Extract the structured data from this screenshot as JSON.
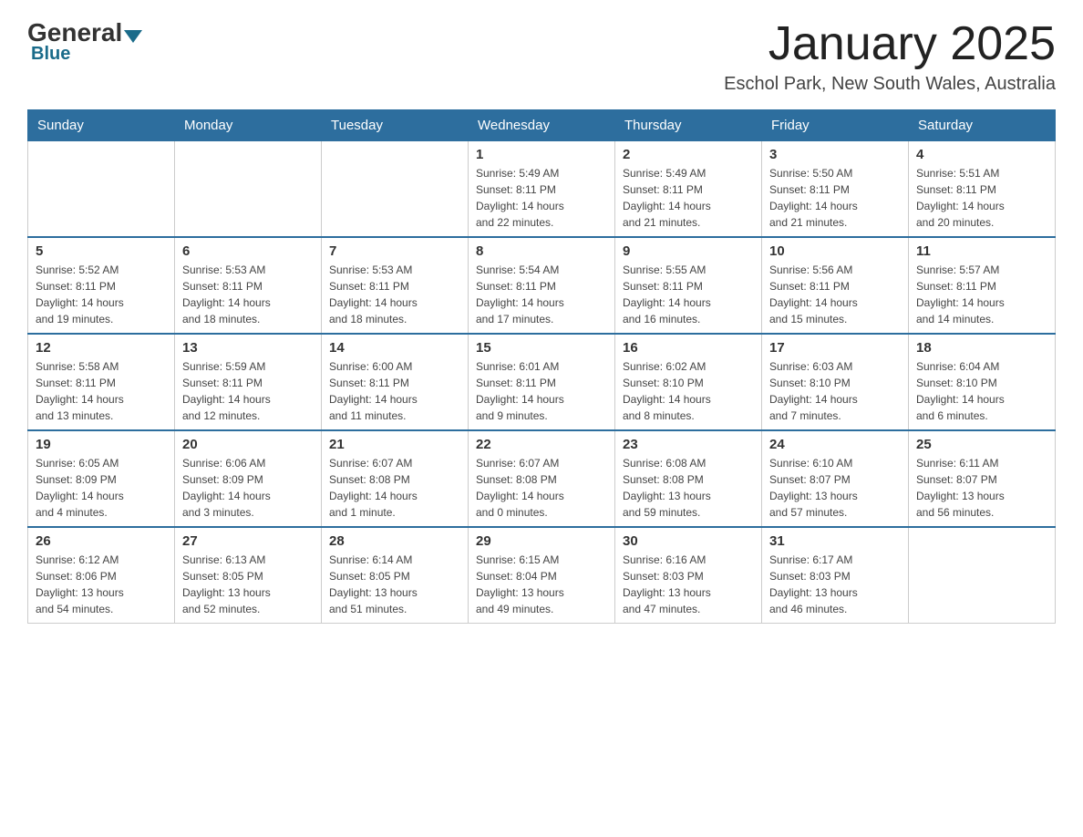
{
  "header": {
    "logo_general": "General",
    "logo_blue": "Blue",
    "month_title": "January 2025",
    "location": "Eschol Park, New South Wales, Australia"
  },
  "weekdays": [
    "Sunday",
    "Monday",
    "Tuesday",
    "Wednesday",
    "Thursday",
    "Friday",
    "Saturday"
  ],
  "weeks": [
    [
      {
        "day": "",
        "info": ""
      },
      {
        "day": "",
        "info": ""
      },
      {
        "day": "",
        "info": ""
      },
      {
        "day": "1",
        "info": "Sunrise: 5:49 AM\nSunset: 8:11 PM\nDaylight: 14 hours\nand 22 minutes."
      },
      {
        "day": "2",
        "info": "Sunrise: 5:49 AM\nSunset: 8:11 PM\nDaylight: 14 hours\nand 21 minutes."
      },
      {
        "day": "3",
        "info": "Sunrise: 5:50 AM\nSunset: 8:11 PM\nDaylight: 14 hours\nand 21 minutes."
      },
      {
        "day": "4",
        "info": "Sunrise: 5:51 AM\nSunset: 8:11 PM\nDaylight: 14 hours\nand 20 minutes."
      }
    ],
    [
      {
        "day": "5",
        "info": "Sunrise: 5:52 AM\nSunset: 8:11 PM\nDaylight: 14 hours\nand 19 minutes."
      },
      {
        "day": "6",
        "info": "Sunrise: 5:53 AM\nSunset: 8:11 PM\nDaylight: 14 hours\nand 18 minutes."
      },
      {
        "day": "7",
        "info": "Sunrise: 5:53 AM\nSunset: 8:11 PM\nDaylight: 14 hours\nand 18 minutes."
      },
      {
        "day": "8",
        "info": "Sunrise: 5:54 AM\nSunset: 8:11 PM\nDaylight: 14 hours\nand 17 minutes."
      },
      {
        "day": "9",
        "info": "Sunrise: 5:55 AM\nSunset: 8:11 PM\nDaylight: 14 hours\nand 16 minutes."
      },
      {
        "day": "10",
        "info": "Sunrise: 5:56 AM\nSunset: 8:11 PM\nDaylight: 14 hours\nand 15 minutes."
      },
      {
        "day": "11",
        "info": "Sunrise: 5:57 AM\nSunset: 8:11 PM\nDaylight: 14 hours\nand 14 minutes."
      }
    ],
    [
      {
        "day": "12",
        "info": "Sunrise: 5:58 AM\nSunset: 8:11 PM\nDaylight: 14 hours\nand 13 minutes."
      },
      {
        "day": "13",
        "info": "Sunrise: 5:59 AM\nSunset: 8:11 PM\nDaylight: 14 hours\nand 12 minutes."
      },
      {
        "day": "14",
        "info": "Sunrise: 6:00 AM\nSunset: 8:11 PM\nDaylight: 14 hours\nand 11 minutes."
      },
      {
        "day": "15",
        "info": "Sunrise: 6:01 AM\nSunset: 8:11 PM\nDaylight: 14 hours\nand 9 minutes."
      },
      {
        "day": "16",
        "info": "Sunrise: 6:02 AM\nSunset: 8:10 PM\nDaylight: 14 hours\nand 8 minutes."
      },
      {
        "day": "17",
        "info": "Sunrise: 6:03 AM\nSunset: 8:10 PM\nDaylight: 14 hours\nand 7 minutes."
      },
      {
        "day": "18",
        "info": "Sunrise: 6:04 AM\nSunset: 8:10 PM\nDaylight: 14 hours\nand 6 minutes."
      }
    ],
    [
      {
        "day": "19",
        "info": "Sunrise: 6:05 AM\nSunset: 8:09 PM\nDaylight: 14 hours\nand 4 minutes."
      },
      {
        "day": "20",
        "info": "Sunrise: 6:06 AM\nSunset: 8:09 PM\nDaylight: 14 hours\nand 3 minutes."
      },
      {
        "day": "21",
        "info": "Sunrise: 6:07 AM\nSunset: 8:08 PM\nDaylight: 14 hours\nand 1 minute."
      },
      {
        "day": "22",
        "info": "Sunrise: 6:07 AM\nSunset: 8:08 PM\nDaylight: 14 hours\nand 0 minutes."
      },
      {
        "day": "23",
        "info": "Sunrise: 6:08 AM\nSunset: 8:08 PM\nDaylight: 13 hours\nand 59 minutes."
      },
      {
        "day": "24",
        "info": "Sunrise: 6:10 AM\nSunset: 8:07 PM\nDaylight: 13 hours\nand 57 minutes."
      },
      {
        "day": "25",
        "info": "Sunrise: 6:11 AM\nSunset: 8:07 PM\nDaylight: 13 hours\nand 56 minutes."
      }
    ],
    [
      {
        "day": "26",
        "info": "Sunrise: 6:12 AM\nSunset: 8:06 PM\nDaylight: 13 hours\nand 54 minutes."
      },
      {
        "day": "27",
        "info": "Sunrise: 6:13 AM\nSunset: 8:05 PM\nDaylight: 13 hours\nand 52 minutes."
      },
      {
        "day": "28",
        "info": "Sunrise: 6:14 AM\nSunset: 8:05 PM\nDaylight: 13 hours\nand 51 minutes."
      },
      {
        "day": "29",
        "info": "Sunrise: 6:15 AM\nSunset: 8:04 PM\nDaylight: 13 hours\nand 49 minutes."
      },
      {
        "day": "30",
        "info": "Sunrise: 6:16 AM\nSunset: 8:03 PM\nDaylight: 13 hours\nand 47 minutes."
      },
      {
        "day": "31",
        "info": "Sunrise: 6:17 AM\nSunset: 8:03 PM\nDaylight: 13 hours\nand 46 minutes."
      },
      {
        "day": "",
        "info": ""
      }
    ]
  ]
}
